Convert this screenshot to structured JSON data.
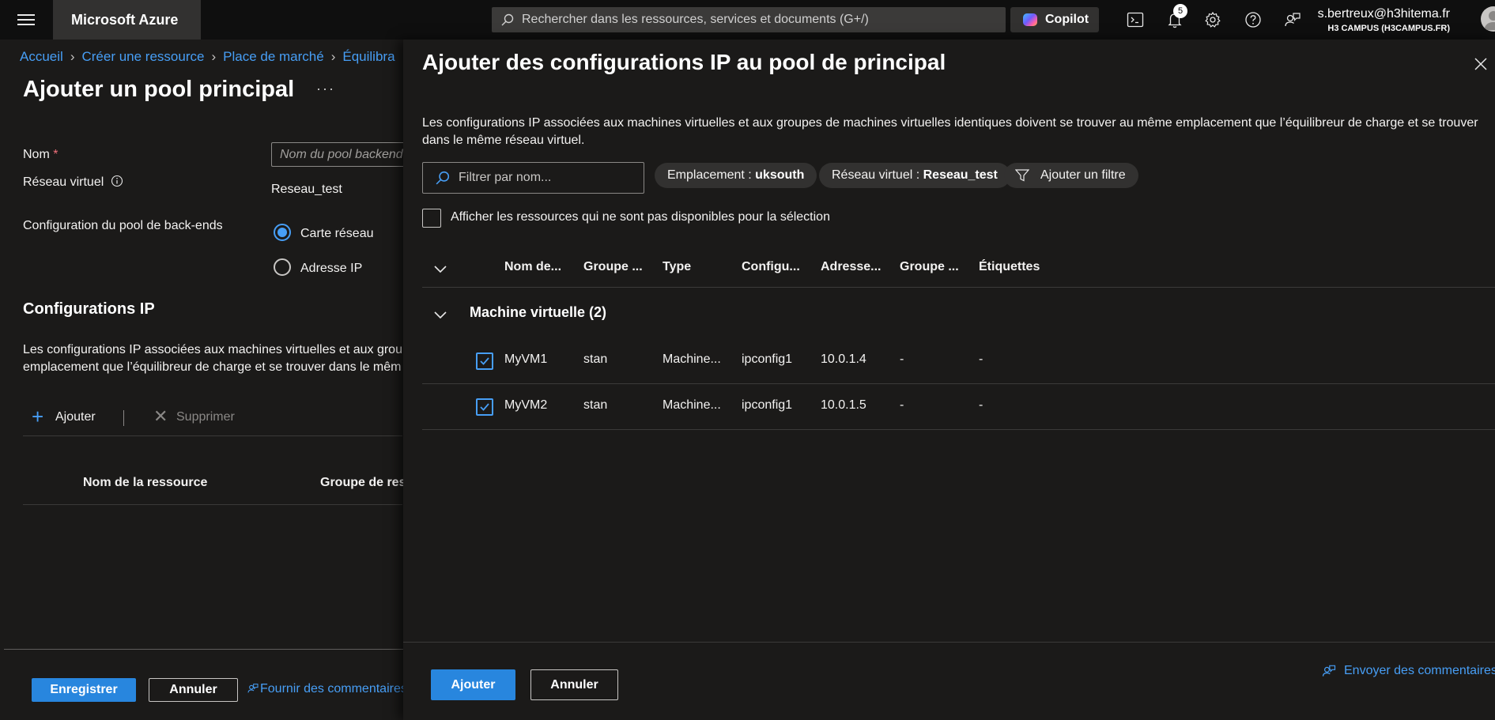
{
  "topbar": {
    "brand": "Microsoft Azure",
    "search_placeholder": "Rechercher dans les ressources, services et documents (G+/)",
    "copilot_label": "Copilot",
    "notification_count": "5",
    "user_email": "s.bertreux@h3hitema.fr",
    "user_tenant": "H3 CAMPUS (H3CAMPUS.FR)"
  },
  "breadcrumb": [
    "Accueil",
    "Créer une ressource",
    "Place de marché",
    "Équilibra"
  ],
  "left": {
    "title": "Ajouter un pool principal",
    "more": "···",
    "name_label": "Nom",
    "name_required": "*",
    "name_placeholder": "Nom du pool backend",
    "vnet_label": "Réseau virtuel",
    "vnet_value": "Reseau_test",
    "pool_config_label": "Configuration du pool de back-ends",
    "radio_nic": "Carte réseau",
    "radio_ip": "Adresse IP",
    "ipconfig_title": "Configurations IP",
    "ipconfig_desc_line1": "Les configurations IP associées aux machines virtuelles et aux group",
    "ipconfig_desc_line2": "emplacement que l’équilibreur de charge et se trouver dans le mêm",
    "add": "Ajouter",
    "delete": "Supprimer",
    "col_resource": "Nom de la ressource",
    "col_group": "Groupe de res",
    "save": "Enregistrer",
    "cancel": "Annuler",
    "feedback": "Fournir des commentaires"
  },
  "panel": {
    "title": "Ajouter des configurations IP au pool de principal",
    "description": "Les configurations IP associées aux machines virtuelles et aux groupes de machines virtuelles identiques doivent se trouver au même emplacement que l’équilibreur de charge et se trouver dans le même réseau virtuel.",
    "filter_placeholder": "Filtrer par nom...",
    "pill_location_key": "Emplacement : ",
    "pill_location_value": "uksouth",
    "pill_vnet_key": "Réseau virtuel : ",
    "pill_vnet_value": "Reseau_test",
    "add_filter": "Ajouter un filtre",
    "show_unavailable": "Afficher les ressources qui ne sont pas disponibles pour la sélection",
    "columns": [
      "Nom de...",
      "Groupe ...",
      "Type",
      "Configu...",
      "Adresse...",
      "Groupe ...",
      "Étiquettes"
    ],
    "group_label": "Machine virtuelle (2)",
    "rows": [
      {
        "checked": true,
        "name": "MyVM1",
        "group": "stan",
        "type": "Machine...",
        "config": "ipconfig1",
        "address": "10.0.1.4",
        "nsg": "-",
        "tags": "-"
      },
      {
        "checked": true,
        "name": "MyVM2",
        "group": "stan",
        "type": "Machine...",
        "config": "ipconfig1",
        "address": "10.0.1.5",
        "nsg": "-",
        "tags": "-"
      }
    ],
    "add_button": "Ajouter",
    "cancel_button": "Annuler",
    "feedback": "Envoyer des commentaires"
  },
  "colors": {
    "accent": "#479ef5",
    "primary_button": "#2886de",
    "background": "#1b1a19",
    "topbar": "#0f0f0f"
  },
  "icons": [
    "hamburger-icon",
    "search-icon",
    "copilot-icon",
    "cloud-shell-icon",
    "bell-icon",
    "gear-icon",
    "help-icon",
    "feedback-icon",
    "info-icon",
    "close-icon",
    "filter-icon",
    "chevron-down-icon",
    "checkmark-icon"
  ]
}
